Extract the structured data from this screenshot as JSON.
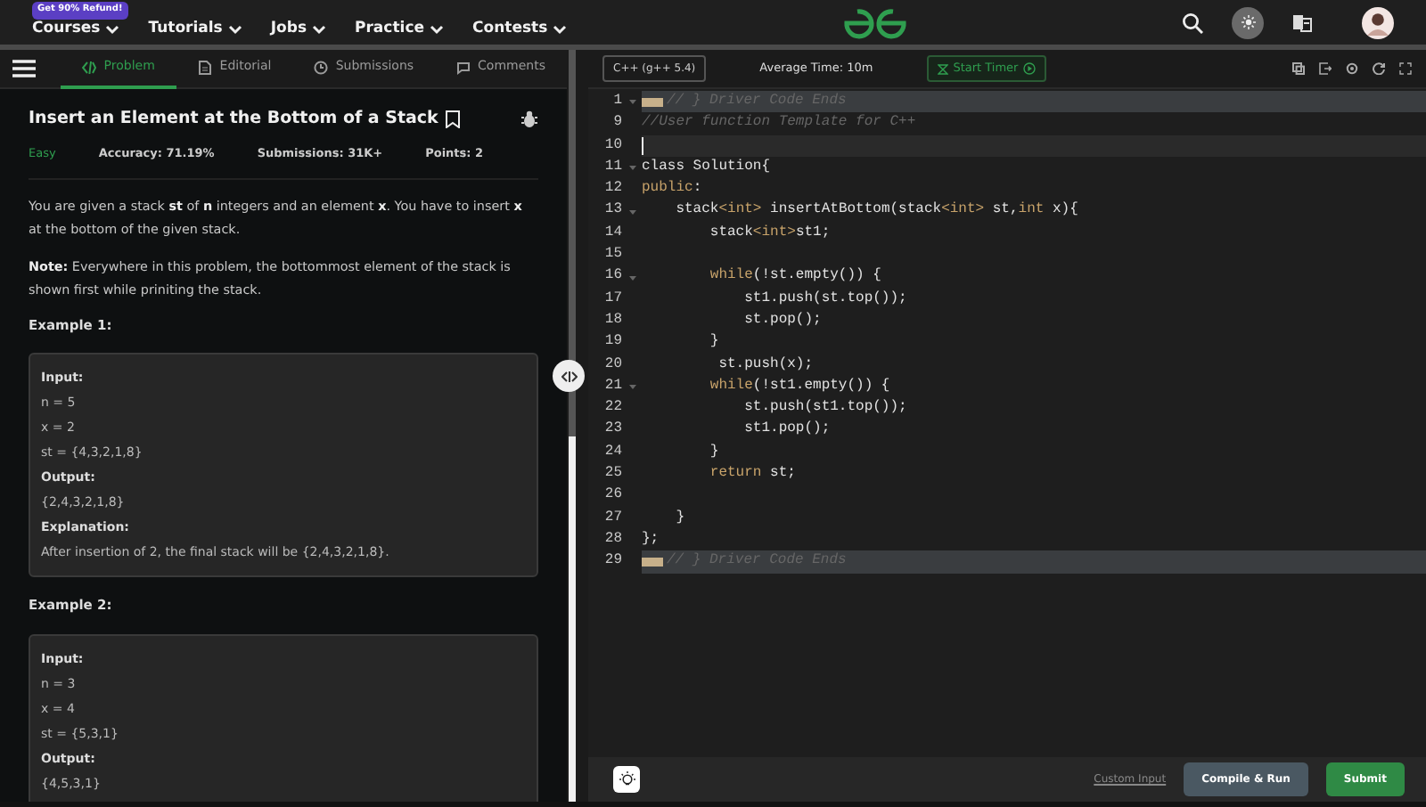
{
  "topnav": {
    "badge": "Get 90% Refund!",
    "items": [
      {
        "label": "Courses"
      },
      {
        "label": "Tutorials"
      },
      {
        "label": "Jobs"
      },
      {
        "label": "Practice"
      },
      {
        "label": "Contests"
      }
    ],
    "theme_toggle": {
      "on": true
    }
  },
  "tabs": [
    {
      "label": "Problem",
      "selected": true
    },
    {
      "label": "Editorial",
      "selected": false
    },
    {
      "label": "Submissions",
      "selected": false
    },
    {
      "label": "Comments",
      "selected": false
    }
  ],
  "problem": {
    "title": "Insert an Element at the Bottom of a Stack",
    "difficulty": "Easy",
    "meta": [
      "Accuracy: 71.19%",
      "Submissions: 31K+",
      "Points: 2"
    ],
    "paragraphs": [
      "You are given a stack **st** of **n** integers and an element **x**. You have to insert **x** at the bottom of the given stack.",
      "**Note:** Everywhere in this problem, the bottommost element of the stack is shown first while priniting the stack."
    ],
    "examples": [
      {
        "heading": "Example 1:",
        "lines": [
          {
            "kind": "label",
            "text": "Input:"
          },
          {
            "kind": "text",
            "text": "n = 5"
          },
          {
            "kind": "text",
            "text": "x = 2"
          },
          {
            "kind": "text",
            "text": "st = {4,3,2,1,8}"
          },
          {
            "kind": "label",
            "text": "Output:"
          },
          {
            "kind": "text",
            "text": "{2,4,3,2,1,8}"
          },
          {
            "kind": "label",
            "text": "Explanation:"
          },
          {
            "kind": "text",
            "text": "After insertion of 2, the final stack will be {2,4,3,2,1,8}."
          }
        ]
      },
      {
        "heading": "Example 2:",
        "lines": [
          {
            "kind": "label",
            "text": "Input:"
          },
          {
            "kind": "text",
            "text": "n = 3"
          },
          {
            "kind": "text",
            "text": "x = 4"
          },
          {
            "kind": "text",
            "text": "st = {5,3,1}"
          },
          {
            "kind": "label",
            "text": "Output:"
          },
          {
            "kind": "text",
            "text": "{4,5,3,1}"
          }
        ]
      }
    ]
  },
  "editor": {
    "language": "C++ (g++ 5.4)",
    "average_time": "Average Time: 10m",
    "timer_button": "Start Timer",
    "lines": [
      {
        "number": "1",
        "foldable": true,
        "folded": true,
        "active": false,
        "tokens": [
          {
            "kind": "comment",
            "text": "// } Driver Code Ends"
          }
        ]
      },
      {
        "number": "9",
        "foldable": false,
        "folded": false,
        "active": false,
        "tokens": [
          {
            "kind": "comment",
            "text": "//User function Template for C++"
          }
        ]
      },
      {
        "number": "10",
        "foldable": false,
        "folded": false,
        "active": true
      },
      {
        "number": "11",
        "foldable": true,
        "folded": false,
        "active": false,
        "tokens": [
          {
            "kind": "plain",
            "text": "class Solution{"
          }
        ]
      },
      {
        "number": "12",
        "foldable": false,
        "folded": false,
        "active": false,
        "tokens": [
          {
            "kind": "keyword",
            "text": "public"
          },
          {
            "kind": "plain",
            "text": ":"
          }
        ]
      },
      {
        "number": "13",
        "foldable": true,
        "folded": false,
        "active": false,
        "tokens": [
          {
            "kind": "plain",
            "text": "    stack"
          },
          {
            "kind": "keyword",
            "text": "<int>"
          },
          {
            "kind": "plain",
            "text": " insertAtBottom(stack"
          },
          {
            "kind": "keyword",
            "text": "<int>"
          },
          {
            "kind": "plain",
            "text": " st,"
          },
          {
            "kind": "keyword",
            "text": "int"
          },
          {
            "kind": "plain",
            "text": " x){"
          }
        ]
      },
      {
        "number": "14",
        "foldable": false,
        "folded": false,
        "active": false,
        "tokens": [
          {
            "kind": "plain",
            "text": "        stack"
          },
          {
            "kind": "keyword",
            "text": "<int>"
          },
          {
            "kind": "plain",
            "text": "st1;"
          }
        ]
      },
      {
        "number": "15",
        "foldable": false,
        "folded": false,
        "active": false
      },
      {
        "number": "16",
        "foldable": true,
        "folded": false,
        "active": false,
        "tokens": [
          {
            "kind": "keyword",
            "text": "        while"
          },
          {
            "kind": "plain",
            "text": "(!st.empty()) {"
          }
        ]
      },
      {
        "number": "17",
        "foldable": false,
        "folded": false,
        "active": false,
        "tokens": [
          {
            "kind": "plain",
            "text": "            st1.push(st.top());"
          }
        ]
      },
      {
        "number": "18",
        "foldable": false,
        "folded": false,
        "active": false,
        "tokens": [
          {
            "kind": "plain",
            "text": "            st.pop();"
          }
        ]
      },
      {
        "number": "19",
        "foldable": false,
        "folded": false,
        "active": false,
        "tokens": [
          {
            "kind": "plain",
            "text": "        }"
          }
        ]
      },
      {
        "number": "20",
        "foldable": false,
        "folded": false,
        "active": false,
        "tokens": [
          {
            "kind": "plain",
            "text": "         st.push(x);"
          }
        ]
      },
      {
        "number": "21",
        "foldable": true,
        "folded": false,
        "active": false,
        "tokens": [
          {
            "kind": "keyword",
            "text": "        while"
          },
          {
            "kind": "plain",
            "text": "(!st1.empty()) {"
          }
        ]
      },
      {
        "number": "22",
        "foldable": false,
        "folded": false,
        "active": false,
        "tokens": [
          {
            "kind": "plain",
            "text": "            st.push(st1.top());"
          }
        ]
      },
      {
        "number": "23",
        "foldable": false,
        "folded": false,
        "active": false,
        "tokens": [
          {
            "kind": "plain",
            "text": "            st1.pop();"
          }
        ]
      },
      {
        "number": "24",
        "foldable": false,
        "folded": false,
        "active": false,
        "tokens": [
          {
            "kind": "plain",
            "text": "        }"
          }
        ]
      },
      {
        "number": "25",
        "foldable": false,
        "folded": false,
        "active": false,
        "tokens": [
          {
            "kind": "keyword",
            "text": "        return"
          },
          {
            "kind": "plain",
            "text": " st;"
          }
        ]
      },
      {
        "number": "26",
        "foldable": false,
        "folded": false,
        "active": false
      },
      {
        "number": "27",
        "foldable": false,
        "folded": false,
        "active": false,
        "tokens": [
          {
            "kind": "plain",
            "text": "    }"
          }
        ]
      },
      {
        "number": "28",
        "foldable": false,
        "folded": false,
        "active": false,
        "tokens": [
          {
            "kind": "plain",
            "text": "};"
          }
        ]
      },
      {
        "number": "29",
        "foldable": false,
        "folded": true,
        "active": false,
        "tokens": [
          {
            "kind": "comment",
            "text": "// } Driver Code Ends"
          }
        ]
      }
    ]
  },
  "footer": {
    "custom_input": "Custom Input",
    "compile_button": "Compile & Run",
    "submit_button": "Submit"
  }
}
